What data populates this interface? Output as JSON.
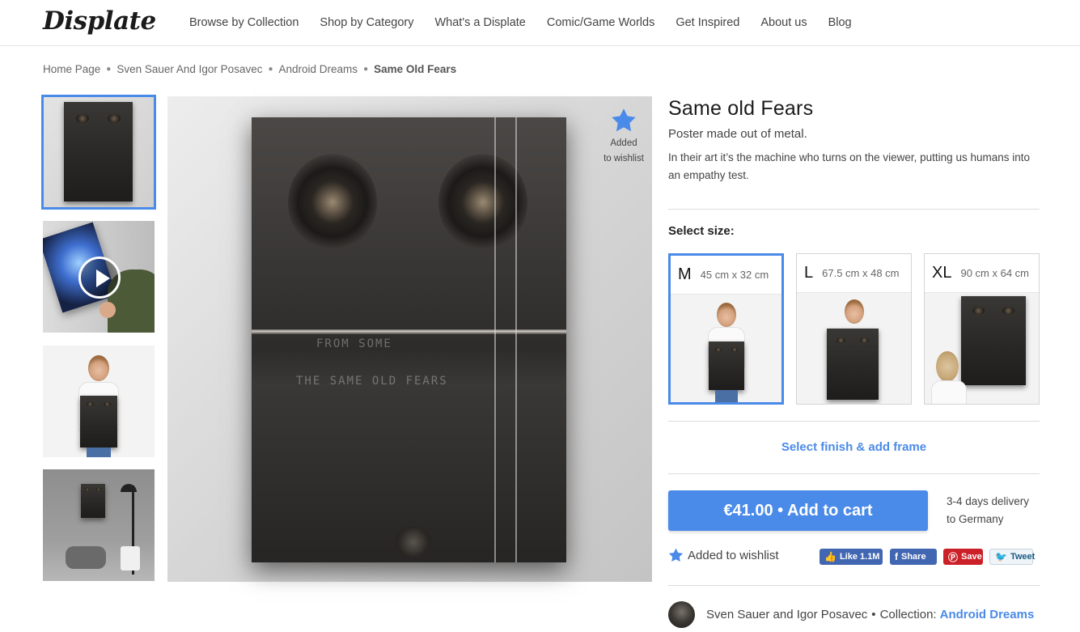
{
  "header": {
    "logo": "Displate",
    "nav": [
      "Browse by Collection",
      "Shop by Category",
      "What's a Displate",
      "Comic/Game Worlds",
      "Get Inspired",
      "About us",
      "Blog"
    ]
  },
  "breadcrumb": {
    "items": [
      "Home Page",
      "Sven Sauer And Igor Posavec",
      "Android Dreams"
    ],
    "current": "Same Old Fears"
  },
  "wishlist_badge": {
    "line1": "Added",
    "line2": "to wishlist"
  },
  "poster_scribbles": [
    "THE SAME OLD FEARS",
    "FROM SOME"
  ],
  "product": {
    "title": "Same old Fears",
    "subtitle": "Poster made out of metal.",
    "description": "In their art it’s the machine who turns on the viewer, putting us humans into an empathy test."
  },
  "sizes": {
    "label": "Select size:",
    "options": [
      {
        "letter": "M",
        "dims": "45 cm x 32 cm",
        "selected": true
      },
      {
        "letter": "L",
        "dims": "67.5 cm x 48 cm",
        "selected": false
      },
      {
        "letter": "XL",
        "dims": "90 cm x 64 cm",
        "selected": false
      }
    ]
  },
  "finish_link": "Select finish & add frame",
  "cart": {
    "button_label": "€41.00 • Add to cart",
    "delivery_line1": "3-4 days delivery",
    "delivery_line2": "to Germany"
  },
  "wishlist_row": "Added to wishlist",
  "social": {
    "like": "Like 1.1M",
    "share": "Share",
    "save": "Save",
    "tweet": "Tweet"
  },
  "author": {
    "name": "Sven Sauer and Igor Posavec",
    "collection_label": "Collection:",
    "collection_name": "Android Dreams"
  },
  "colors": {
    "accent": "#4a8ae8",
    "facebook": "#4267b2",
    "pinterest": "#cb2027"
  }
}
